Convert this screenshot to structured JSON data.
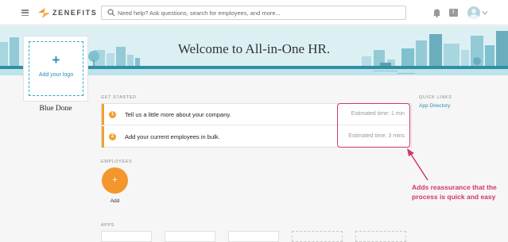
{
  "header": {
    "brand": "ZENEFITS",
    "search_placeholder": "Need help? Ask questions, search for employees, and more...",
    "chat_icon": "!"
  },
  "banner": {
    "welcome": "Welcome to All-in-One HR."
  },
  "company": {
    "plus": "+",
    "add_logo": "Add your logo",
    "name": "Blue Done"
  },
  "get_started": {
    "label": "GET STARTED",
    "tasks": [
      {
        "num": "1",
        "text": "Tell us a little more about your company.",
        "time": "Estimated time: 1 min"
      },
      {
        "num": "2",
        "text": "Add your current employees in bulk.",
        "time": "Estimated time: 3 mins"
      }
    ]
  },
  "quick_links": {
    "label": "QUICK LINKS",
    "items": [
      "App Directory"
    ]
  },
  "employees": {
    "label": "EMPLOYEES",
    "button_icon": "+",
    "add_label": "Add"
  },
  "apps": {
    "label": "APPS"
  },
  "annotation": {
    "text": "Adds reassurance that the process is quick and easy"
  },
  "colors": {
    "accent_orange": "#f0a02f",
    "link_blue": "#2b8fb5",
    "annotation_pink": "#d2356c",
    "banner_bg": "#dcf0f3"
  }
}
